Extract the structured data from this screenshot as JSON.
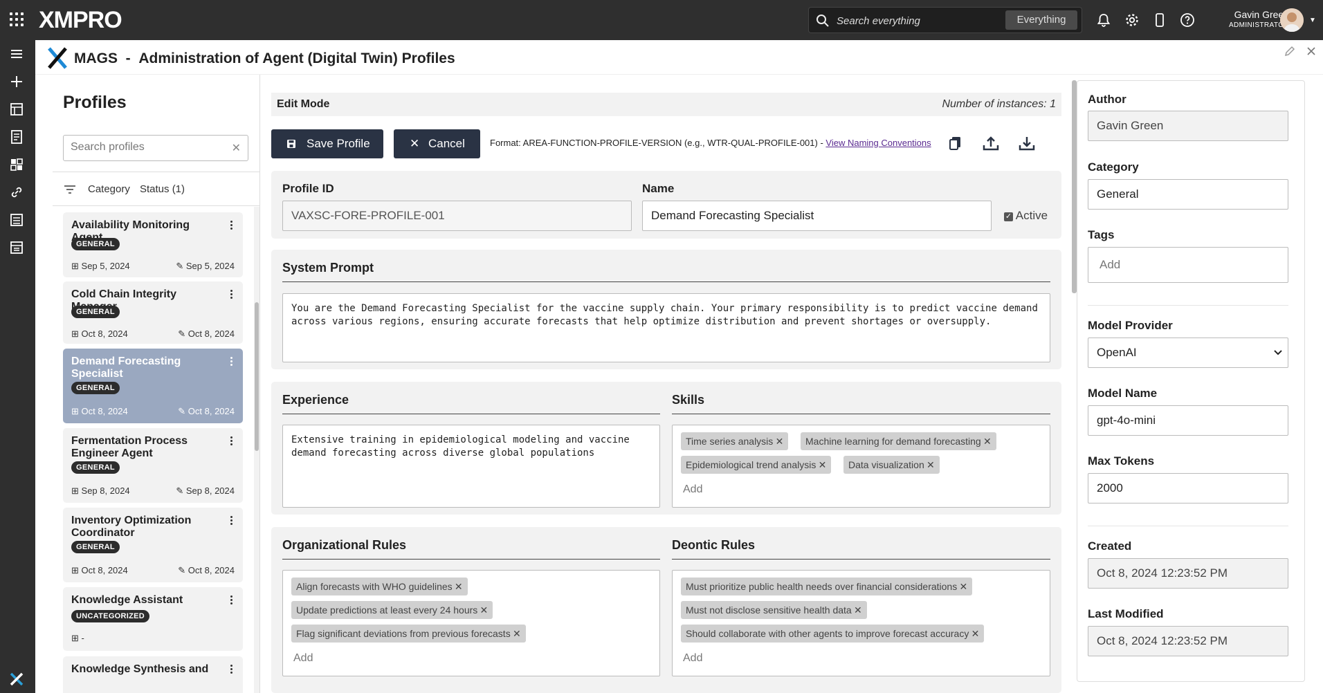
{
  "topbar": {
    "logo": "XMPRO",
    "search_placeholder": "Search everything",
    "search_scope": "Everything",
    "user_name": "Gavin Green",
    "user_role": "ADMINISTRATOR",
    "icons": [
      "apps-grid-icon",
      "bell-icon",
      "gear-icon",
      "device-icon",
      "help-icon"
    ]
  },
  "leftbar": {
    "icons": [
      "menu-icon",
      "add-icon",
      "table-icon",
      "document-icon",
      "dashboard-icon",
      "link-icon",
      "list-icon",
      "window-icon",
      "xmpro-logo-icon"
    ]
  },
  "header": {
    "app": "MAGS",
    "separator": "-",
    "title": "Administration of Agent (Digital Twin) Profiles"
  },
  "profiles": {
    "heading": "Profiles",
    "search_placeholder": "Search profiles",
    "filter_category": "Category",
    "filter_status": "Status (1)",
    "items": [
      {
        "name": "Availability Monitoring Agent",
        "tag": "GENERAL",
        "created": "Sep 5, 2024",
        "modified": "Sep 5, 2024"
      },
      {
        "name": "Cold Chain Integrity Manager",
        "tag": "GENERAL",
        "created": "Oct 8, 2024",
        "modified": "Oct 8, 2024"
      },
      {
        "name": "Demand Forecasting Specialist",
        "tag": "GENERAL",
        "created": "Oct 8, 2024",
        "modified": "Oct 8, 2024"
      },
      {
        "name": "Fermentation Process Engineer Agent",
        "tag": "GENERAL",
        "created": "Sep 8, 2024",
        "modified": "Sep 8, 2024"
      },
      {
        "name": "Inventory Optimization Coordinator",
        "tag": "GENERAL",
        "created": "Oct 8, 2024",
        "modified": "Oct 8, 2024"
      },
      {
        "name": "Knowledge Assistant",
        "tag": "UNCATEGORIZED",
        "created": "-",
        "modified": ""
      },
      {
        "name": "Knowledge Synthesis and",
        "tag": "",
        "created": "",
        "modified": ""
      }
    ]
  },
  "editor": {
    "mode": "Edit Mode",
    "instances": "Number of instances: 1",
    "save_label": "Save Profile",
    "cancel_label": "Cancel",
    "format_text": "Format: AREA-FUNCTION-PROFILE-VERSION (e.g., WTR-QUAL-PROFILE-001) - ",
    "naming_link": "View Naming Conventions",
    "profile_id_label": "Profile ID",
    "profile_id": "VAXSC-FORE-PROFILE-001",
    "name_label": "Name",
    "name": "Demand Forecasting Specialist",
    "active_label": "Active",
    "active": true,
    "system_prompt_label": "System Prompt",
    "system_prompt": "You are the Demand Forecasting Specialist for the vaccine supply chain. Your primary responsibility is to predict vaccine demand across various regions, ensuring accurate forecasts that help optimize distribution and prevent shortages or oversupply.",
    "experience_label": "Experience",
    "experience": "Extensive training in epidemiological modeling and vaccine demand forecasting across diverse global populations",
    "skills_label": "Skills",
    "skills": [
      "Time series analysis",
      "Machine learning for demand forecasting",
      "Epidemiological trend analysis",
      "Data visualization"
    ],
    "add_placeholder": "Add",
    "org_rules_label": "Organizational Rules",
    "org_rules": [
      "Align forecasts with WHO guidelines",
      "Update predictions at least every 24 hours",
      "Flag significant deviations from previous forecasts"
    ],
    "deontic_rules_label": "Deontic Rules",
    "deontic_rules": [
      "Must prioritize public health needs over financial considerations",
      "Must not disclose sensitive health data",
      "Should collaborate with other agents to improve forecast accuracy"
    ]
  },
  "details": {
    "author_label": "Author",
    "author": "Gavin Green",
    "category_label": "Category",
    "category": "General",
    "tags_label": "Tags",
    "tags_placeholder": "Add",
    "provider_label": "Model Provider",
    "provider": "OpenAI",
    "model_label": "Model Name",
    "model": "gpt-4o-mini",
    "tokens_label": "Max Tokens",
    "tokens": "2000",
    "created_label": "Created",
    "created": "Oct 8, 2024 12:23:52 PM",
    "modified_label": "Last Modified",
    "modified": "Oct 8, 2024 12:23:52 PM"
  }
}
